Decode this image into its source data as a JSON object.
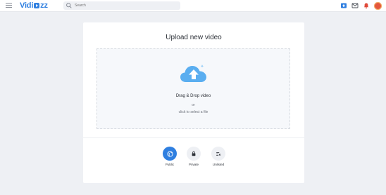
{
  "header": {
    "logo_left": "Vidi",
    "logo_right": "zz",
    "search_placeholder": "Search",
    "icons": [
      "menu-icon",
      "search-icon",
      "upload-icon",
      "mail-icon",
      "bell-icon",
      "avatar"
    ]
  },
  "upload": {
    "title": "Upload new video",
    "drop_text": "Drag & Drop video",
    "or_text": "or",
    "select_text": "click to select a file",
    "icon": "cloud-upload-icon"
  },
  "visibility": {
    "options": [
      {
        "label": "Public",
        "icon": "globe-icon",
        "selected": true
      },
      {
        "label": "Private",
        "icon": "lock-icon",
        "selected": false
      },
      {
        "label": "Unlisted",
        "icon": "list-icon",
        "selected": false
      }
    ]
  },
  "colors": {
    "accent": "#2f7fe0",
    "background": "#eef0f4",
    "cloud": "#5aaef0"
  }
}
